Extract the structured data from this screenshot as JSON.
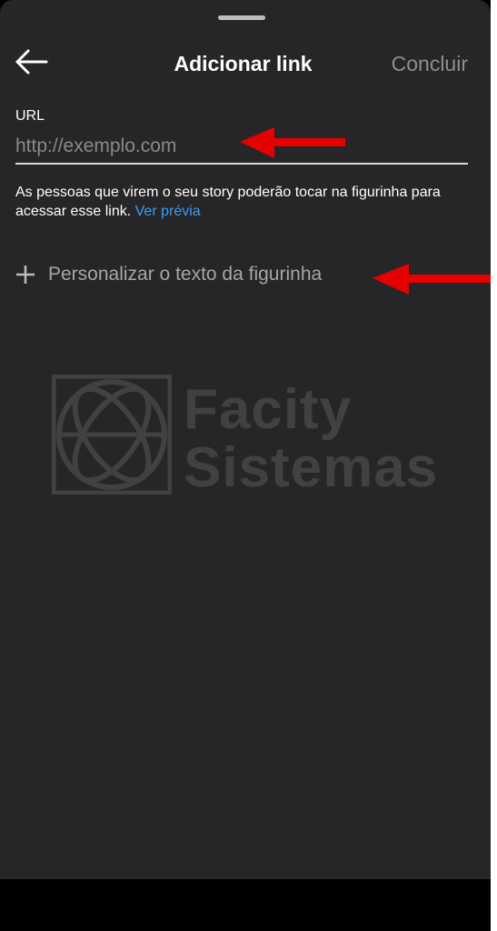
{
  "header": {
    "title": "Adicionar link",
    "back_icon": "arrow-left-icon",
    "done_label": "Concluir"
  },
  "url_field": {
    "label": "URL",
    "placeholder": "http://exemplo.com",
    "value": ""
  },
  "helper": {
    "text": "As pessoas que virem o seu story poderão tocar na figurinha para acessar esse link.",
    "preview_link": "Ver prévia"
  },
  "customize": {
    "icon": "plus-icon",
    "label": "Personalizar o texto da figurinha"
  },
  "watermark": {
    "line1": "Facity",
    "line2": "Sistemas"
  },
  "colors": {
    "sheet_background": "#262628",
    "link_blue": "#3b9cf2",
    "annotation_red": "#e60000",
    "done_gray": "#8e8e8e"
  }
}
